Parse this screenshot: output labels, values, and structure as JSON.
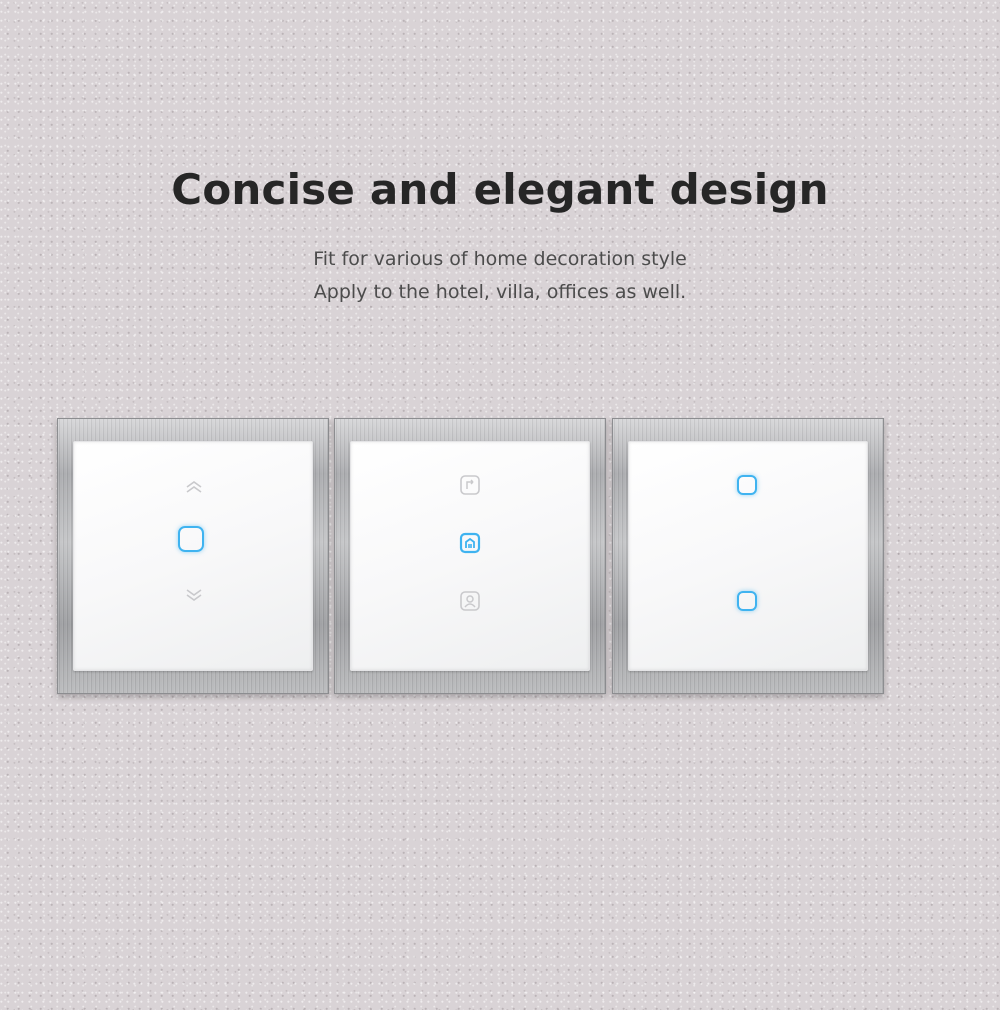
{
  "headline": "Concise and elegant design",
  "sublines": [
    "Fit for various of home decoration style",
    "Apply to the hotel, villa, offices as well."
  ],
  "colors": {
    "background": "#d9d3d6",
    "indicator": "#3fb3f0",
    "faint_icon": "#c9c9cc",
    "text": "#262626"
  },
  "switches": [
    {
      "variant": "curtain",
      "icons": [
        "chevron-up-icon",
        "touch-key-icon",
        "chevron-down-icon"
      ]
    },
    {
      "variant": "scene",
      "icons": [
        "scene-icon",
        "home-icon",
        "person-icon"
      ]
    },
    {
      "variant": "two-gang",
      "icons": [
        "touch-key-icon",
        "touch-key-icon"
      ]
    }
  ]
}
